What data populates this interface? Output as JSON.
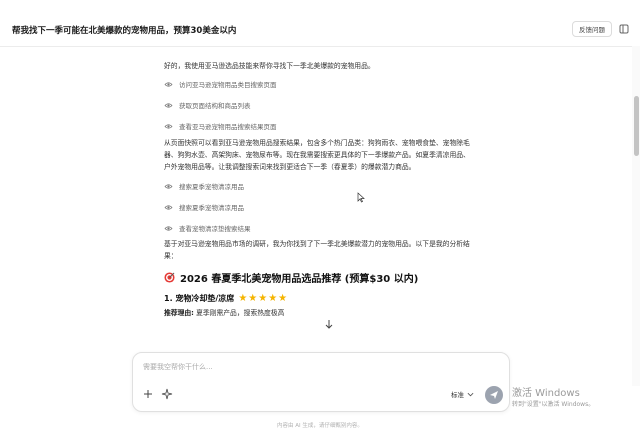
{
  "header": {
    "title": "帮我找下一季可能在北美爆款的宠物用品，预算30美金以内",
    "feedback_label": "反馈问题"
  },
  "message": {
    "intro": "好的，我使用亚马逊选品技能来帮你寻找下一季北美爆款的宠物用品。",
    "steps_a": [
      "访问亚马逊宠物用品类目搜索页面",
      "获取页面结构和商品列表",
      "查看亚马逊宠物用品搜索结果页面"
    ],
    "analysis_line1": "从页面快照可以看到亚马逊宠物用品搜索结果，包含多个热门品类：狗狗雨衣、宠物喂食垫、宠物除毛",
    "analysis_line2": "器、狗狗水壶、高架狗床、宠物尿布等。现在我需要搜索更具体的下一季爆款产品。如夏季清凉用品、",
    "analysis_line3": "户外宠物用品等。让我调整搜索词来找到更适合下一季（春夏季）的爆款潜力商品。",
    "steps_b": [
      "搜索夏季宠物清凉用品",
      "搜索夏季宠物清凉用品",
      "查看宠物清凉垫搜索结果"
    ],
    "summary_line1": "基于对亚马逊宠物用品市场的调研，我为你找到了下一季北美爆款潜力的宠物用品。以下是我的分析结",
    "summary_line2": "果：",
    "section_title": "2026 春夏季北美宠物用品选品推荐 (预算$30 以内)",
    "item1_title": "1. 宠物冷却垫/凉席",
    "item1_stars": "★★★★★",
    "item1_rating": 5,
    "item1_reason_label": "推荐理由:",
    "item1_reason": "夏季刚需产品，搜索热度极高"
  },
  "composer": {
    "placeholder": "需要我空帮你干什么...",
    "mode_label": "标准"
  },
  "footer_note": "内容由 AI 生成，请仔细甄别内容。",
  "watermark": {
    "line1": "激活 Windows",
    "line2": "转到\"设置\"以激活 Windows。"
  },
  "icons": {
    "step": "eye-icon",
    "section": "target-icon",
    "send": "send-icon",
    "add": "plus-icon",
    "skill": "sparkle-icon",
    "scroll": "arrow-down-icon"
  },
  "colors": {
    "star": "#f5b400",
    "send_button": "#9ca3af",
    "target_red": "#e53935"
  }
}
